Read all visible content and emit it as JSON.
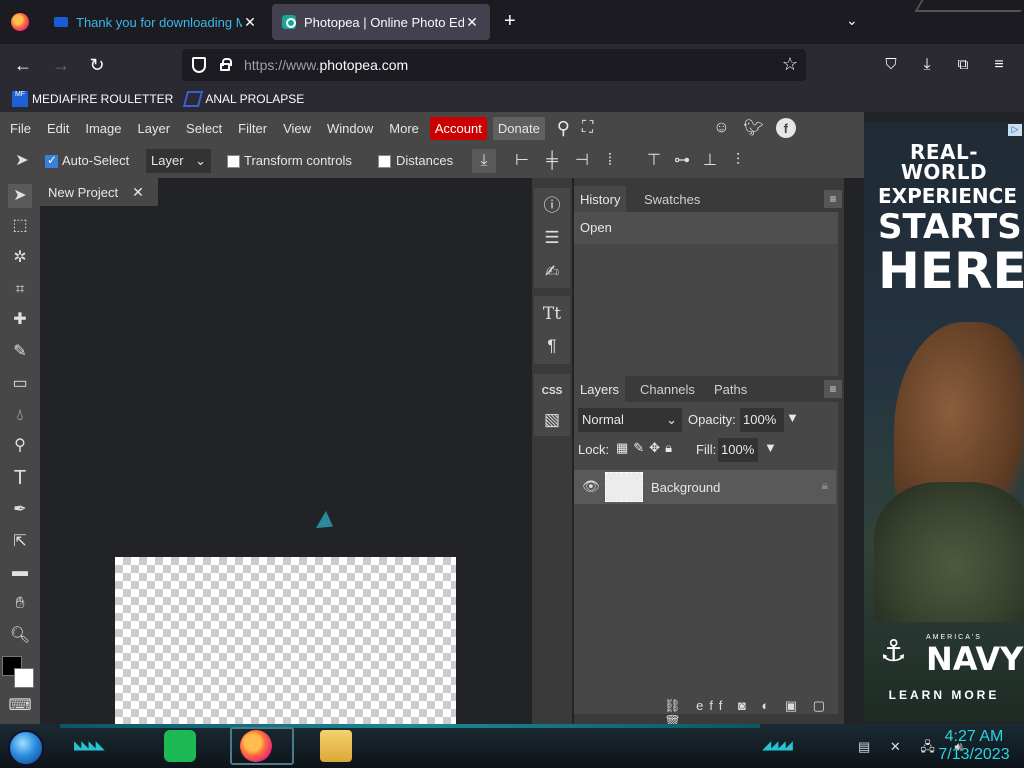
{
  "browser": {
    "tabs": [
      {
        "label": "Thank you for downloading M",
        "active": false
      },
      {
        "label": "Photopea | Online Photo Editor",
        "active": true
      }
    ],
    "url_prefix": "https://www.",
    "url_domain": "photopea.com",
    "bookmarks": [
      {
        "label": "MEDIAFIRE ROULETTER",
        "icon": "mediafire-icon"
      },
      {
        "label": "ANAL PROLAPSE",
        "icon": "bookmark-icon"
      }
    ]
  },
  "app": {
    "menu": [
      "File",
      "Edit",
      "Image",
      "Layer",
      "Select",
      "Filter",
      "View",
      "Window",
      "More"
    ],
    "account_label": "Account",
    "donate_label": "Donate",
    "options": {
      "auto_select": "Auto-Select",
      "auto_select_target": "Layer",
      "transform_controls": "Transform controls",
      "distances": "Distances"
    },
    "doc_tab": "New Project",
    "history": {
      "tabs": [
        "History",
        "Swatches"
      ],
      "items": [
        "Open"
      ]
    },
    "layers": {
      "tabs": [
        "Layers",
        "Channels",
        "Paths"
      ],
      "blend_mode": "Normal",
      "opacity_label": "Opacity:",
      "opacity": "100%",
      "lock_label": "Lock:",
      "fill_label": "Fill:",
      "fill": "100%",
      "items": [
        {
          "name": "Background",
          "visible": true,
          "locked": true
        }
      ]
    },
    "iconstrip": {
      "css_label": "CSS"
    }
  },
  "ad": {
    "line1": "REAL-WORLD",
    "line2": "EXPERIENCE",
    "line3": "STARTS",
    "line4": "HERE",
    "brand": "NAVY",
    "brand_small": "AMERICA'S",
    "cta": "LEARN MORE"
  },
  "taskbar": {
    "time": "4:27 AM",
    "date": "7/13/2023"
  },
  "colors": {
    "accent_account": "#cc0000",
    "panel_bg": "#474747",
    "canvas_bg": "#222326",
    "clock": "#2ad4e0"
  }
}
